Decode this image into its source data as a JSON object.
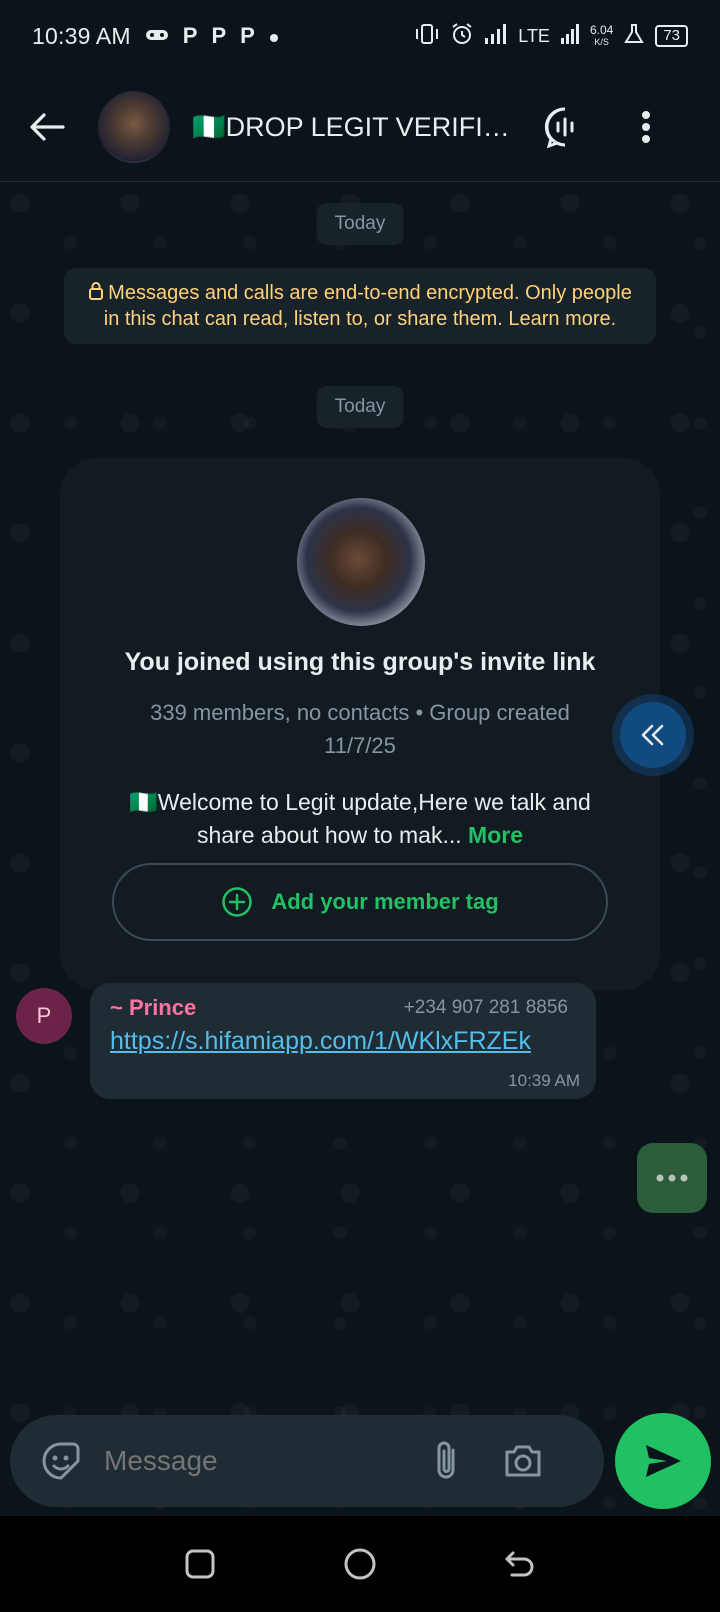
{
  "status_bar": {
    "time": "10:39 AM",
    "notification_glyphs": [
      "P",
      "P",
      "P"
    ],
    "network": "LTE",
    "speed_value": "6.04",
    "speed_unit": "K/S",
    "battery": "73"
  },
  "header": {
    "flag": "🇳🇬",
    "title": "DROP LEGIT VERIFIED..."
  },
  "chat": {
    "date_chip_1": "Today",
    "encryption_notice": "Messages and calls are end-to-end encrypted. Only people in this chat can read, listen to, or share them. Learn more.",
    "date_chip_2": "Today",
    "group_card": {
      "title": "You joined using this group's invite link",
      "meta": "339 members, no contacts • Group created 11/7/25",
      "description": "🇳🇬Welcome to Legit update,Here we talk and share about how to mak...",
      "more_label": "More",
      "member_tag_label": "Add your member tag"
    },
    "message": {
      "avatar_initial": "P",
      "sender": "~ Prince",
      "phone": "+234 907 281 8856",
      "link": "https://s.hifamiapp.com/1/WKlxFRZEk",
      "time": "10:39 AM"
    }
  },
  "composer": {
    "placeholder": "Message"
  },
  "colors": {
    "background": "#0b141a",
    "accent_green": "#21c063",
    "notice_yellow": "#ffd279",
    "sender_pink": "#ff72a1",
    "link_blue": "#53bdeb"
  },
  "icons": [
    "back-arrow-icon",
    "voice-chat-icon",
    "more-vert-icon",
    "lock-icon",
    "plus-circle-icon",
    "double-chevron-left-icon",
    "dots-icon",
    "sticker-icon",
    "paperclip-icon",
    "camera-icon",
    "send-icon",
    "recents-icon",
    "home-icon",
    "back-nav-icon"
  ]
}
